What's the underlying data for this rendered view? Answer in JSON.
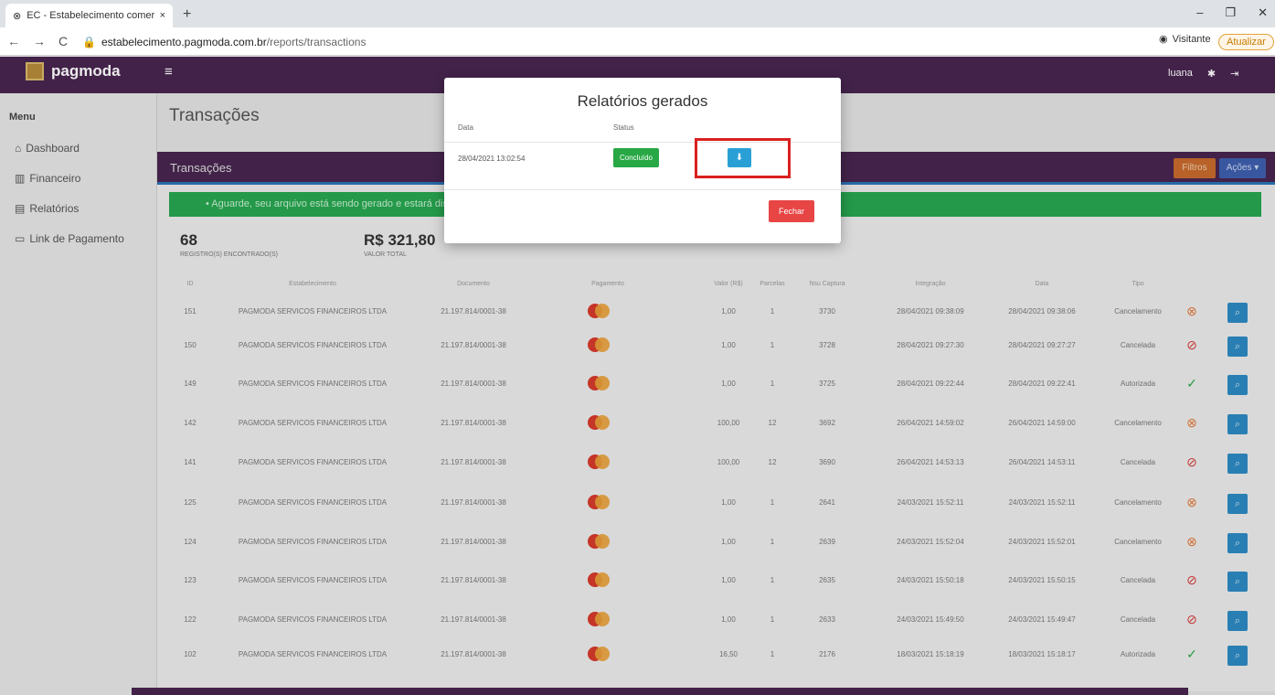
{
  "browser": {
    "tab_title": "EC - Estabelecimento comercial",
    "tab_close": "×",
    "new_tab": "+",
    "url_host": "estabelecimento.pagmoda.com.br",
    "url_path": "/reports/transactions",
    "profile_label": "Visitante",
    "update_label": "Atualizar"
  },
  "navbar": {
    "logo_text": "pagmoda",
    "user": "luana"
  },
  "sidebar": {
    "header": "Menu",
    "items": [
      {
        "icon": "home-icon",
        "label": "Dashboard"
      },
      {
        "icon": "bar-chart-icon",
        "label": "Financeiro"
      },
      {
        "icon": "file-icon",
        "label": "Relatórios"
      },
      {
        "icon": "card-icon",
        "label": "Link de Pagamento"
      }
    ]
  },
  "page": {
    "title": "Transações",
    "card_title": "Transações",
    "filters_label": "Filtros",
    "actions_label": "Ações ▾",
    "alert_text": "• Aguarde, seu arquivo está sendo gerado e estará disponível",
    "records_count": "68",
    "records_label": "REGISTRO(S) ENCONTRADO(S)",
    "total_value": "R$ 321,80",
    "total_label": "VALOR TOTAL"
  },
  "table": {
    "columns": [
      "ID",
      "Estabelecimento",
      "Documento",
      "Pagamento",
      "Valor (R$)",
      "Parcelas",
      "Nsu Captura",
      "Integração",
      "Data",
      "Tipo"
    ],
    "rows": [
      {
        "id": "151",
        "estab": "PAGMODA SERVICOS FINANCEIROS LTDA",
        "doc": "21.197.814/0001-38",
        "valor": "1,00",
        "parcelas": "1",
        "nsu": "3730",
        "integracao": "28/04/2021 09:38:09",
        "data": "28/04/2021 09:38:06",
        "tipo": "Cancelamento",
        "status": "cancel-pending"
      },
      {
        "id": "150",
        "estab": "PAGMODA SERVICOS FINANCEIROS LTDA",
        "doc": "21.197.814/0001-38",
        "valor": "1,00",
        "parcelas": "1",
        "nsu": "3728",
        "integracao": "28/04/2021 09:27:30",
        "data": "28/04/2021 09:27:27",
        "tipo": "Cancelada",
        "status": "cancelled"
      },
      {
        "id": "149",
        "estab": "PAGMODA SERVICOS FINANCEIROS LTDA",
        "doc": "21.197.814/0001-38",
        "valor": "1,00",
        "parcelas": "1",
        "nsu": "3725",
        "integracao": "28/04/2021 09:22:44",
        "data": "28/04/2021 09:22:41",
        "tipo": "Autorizada",
        "status": "authorized"
      },
      {
        "id": "142",
        "estab": "PAGMODA SERVICOS FINANCEIROS LTDA",
        "doc": "21.197.814/0001-38",
        "valor": "100,00",
        "parcelas": "12",
        "nsu": "3692",
        "integracao": "26/04/2021 14:59:02",
        "data": "26/04/2021 14:59:00",
        "tipo": "Cancelamento",
        "status": "cancel-pending"
      },
      {
        "id": "141",
        "estab": "PAGMODA SERVICOS FINANCEIROS LTDA",
        "doc": "21.197.814/0001-38",
        "valor": "100,00",
        "parcelas": "12",
        "nsu": "3690",
        "integracao": "26/04/2021 14:53:13",
        "data": "26/04/2021 14:53:11",
        "tipo": "Cancelada",
        "status": "cancelled"
      },
      {
        "id": "125",
        "estab": "PAGMODA SERVICOS FINANCEIROS LTDA",
        "doc": "21.197.814/0001-38",
        "valor": "1,00",
        "parcelas": "1",
        "nsu": "2641",
        "integracao": "24/03/2021 15:52:11",
        "data": "24/03/2021 15:52:11",
        "tipo": "Cancelamento",
        "status": "cancel-pending"
      },
      {
        "id": "124",
        "estab": "PAGMODA SERVICOS FINANCEIROS LTDA",
        "doc": "21.197.814/0001-38",
        "valor": "1,00",
        "parcelas": "1",
        "nsu": "2639",
        "integracao": "24/03/2021 15:52:04",
        "data": "24/03/2021 15:52:01",
        "tipo": "Cancelamento",
        "status": "cancel-pending"
      },
      {
        "id": "123",
        "estab": "PAGMODA SERVICOS FINANCEIROS LTDA",
        "doc": "21.197.814/0001-38",
        "valor": "1,00",
        "parcelas": "1",
        "nsu": "2635",
        "integracao": "24/03/2021 15:50:18",
        "data": "24/03/2021 15:50:15",
        "tipo": "Cancelada",
        "status": "cancelled"
      },
      {
        "id": "122",
        "estab": "PAGMODA SERVICOS FINANCEIROS LTDA",
        "doc": "21.197.814/0001-38",
        "valor": "1,00",
        "parcelas": "1",
        "nsu": "2633",
        "integracao": "24/03/2021 15:49:50",
        "data": "24/03/2021 15:49:47",
        "tipo": "Cancelada",
        "status": "cancelled"
      },
      {
        "id": "102",
        "estab": "PAGMODA SERVICOS FINANCEIROS LTDA",
        "doc": "21.197.814/0001-38",
        "valor": "16,50",
        "parcelas": "1",
        "nsu": "2176",
        "integracao": "18/03/2021 15:18:19",
        "data": "18/03/2021 15:18:17",
        "tipo": "Autorizada",
        "status": "authorized"
      }
    ]
  },
  "modal": {
    "title": "Relatórios gerados",
    "col_date": "Data",
    "col_status": "Status",
    "date": "28/04/2021 13:02:54",
    "status": "Concluído",
    "close_label": "Fechar"
  },
  "colors": {
    "brand_purple": "#482550",
    "success_green": "#27a844",
    "danger_red": "#e84545",
    "info_blue": "#2a9fd6",
    "highlight_red": "#d9201f"
  }
}
